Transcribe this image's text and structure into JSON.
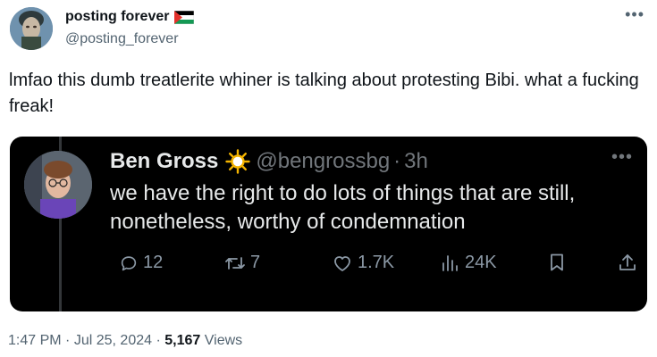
{
  "tweet": {
    "display_name": "posting forever",
    "handle": "@posting_forever",
    "more": "•••",
    "text": "lmfao this dumb treatlerite whiner is talking about protesting Bibi. what a fucking freak!"
  },
  "quote": {
    "display_name": "Ben Gross",
    "handle": "@bengrossbg",
    "separator": "·",
    "time": "3h",
    "more": "•••",
    "text": "we have the right to do lots of things that are still, nonetheless, worthy of condemnation",
    "actions": {
      "replies": "12",
      "reposts": "7",
      "likes": "1.7K",
      "views": "24K"
    }
  },
  "footer": {
    "time": "1:47 PM",
    "sep1": "·",
    "date": "Jul 25, 2024",
    "sep2": "·",
    "views_count": "5,167",
    "views_label": "Views"
  },
  "colors": {
    "quote_background": "#000000",
    "secondary_text": "#536471",
    "quote_secondary": "#71767b"
  },
  "icons": [
    "palestine-flag-icon",
    "sun-emoji-icon",
    "reply-icon",
    "repost-icon",
    "like-icon",
    "views-icon",
    "bookmark-icon",
    "share-icon"
  ]
}
